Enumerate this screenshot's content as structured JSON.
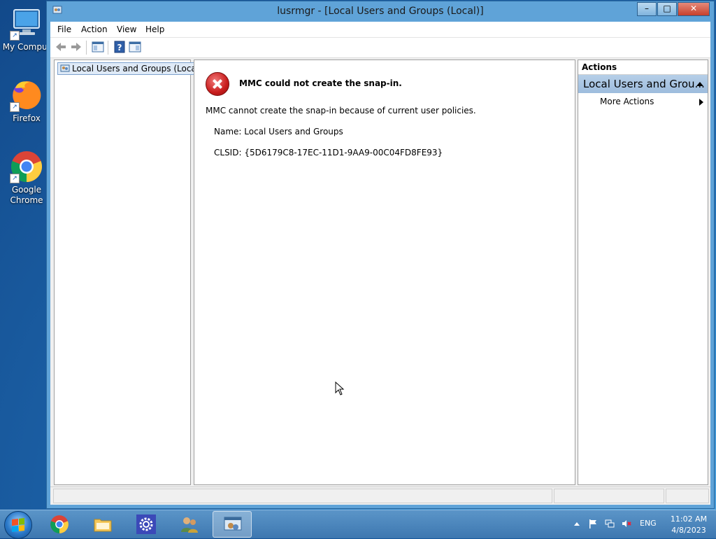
{
  "desktop": {
    "icons": [
      {
        "label": "My Comput",
        "icon": "computer-icon"
      },
      {
        "label": "Firefox",
        "icon": "firefox-icon"
      },
      {
        "label": "Google Chrome",
        "icon": "chrome-icon"
      }
    ]
  },
  "window": {
    "title": "lusrmgr - [Local Users and Groups (Local)]",
    "buttons": {
      "minimize": "–",
      "maximize": "□",
      "close": "✕"
    }
  },
  "menubar": {
    "items": [
      "File",
      "Action",
      "View",
      "Help"
    ]
  },
  "tree": {
    "root": "Local Users and Groups (Local)"
  },
  "content": {
    "error_title": "MMC could not create the snap-in.",
    "error_message": "MMC cannot create the snap-in because of current user policies.",
    "name_line": "Name: Local Users and Groups",
    "clsid_line": "CLSID: {5D6179C8-17EC-11D1-9AA9-00C04FD8FE93}"
  },
  "actions": {
    "header": "Actions",
    "group": "Local Users and Grou...",
    "item": "More Actions"
  },
  "taskbar": {
    "apps": [
      "chrome-icon",
      "file-explorer-icon",
      "settings-icon",
      "users-icon",
      "mmc-icon"
    ],
    "active_app": "mmc-icon"
  },
  "tray": {
    "language": "ENG",
    "time": "11:02 AM",
    "date": "4/8/2023"
  },
  "colors": {
    "accent": "#5fa3d8",
    "error": "#c81d1d",
    "selection": "#dfeaf7"
  }
}
